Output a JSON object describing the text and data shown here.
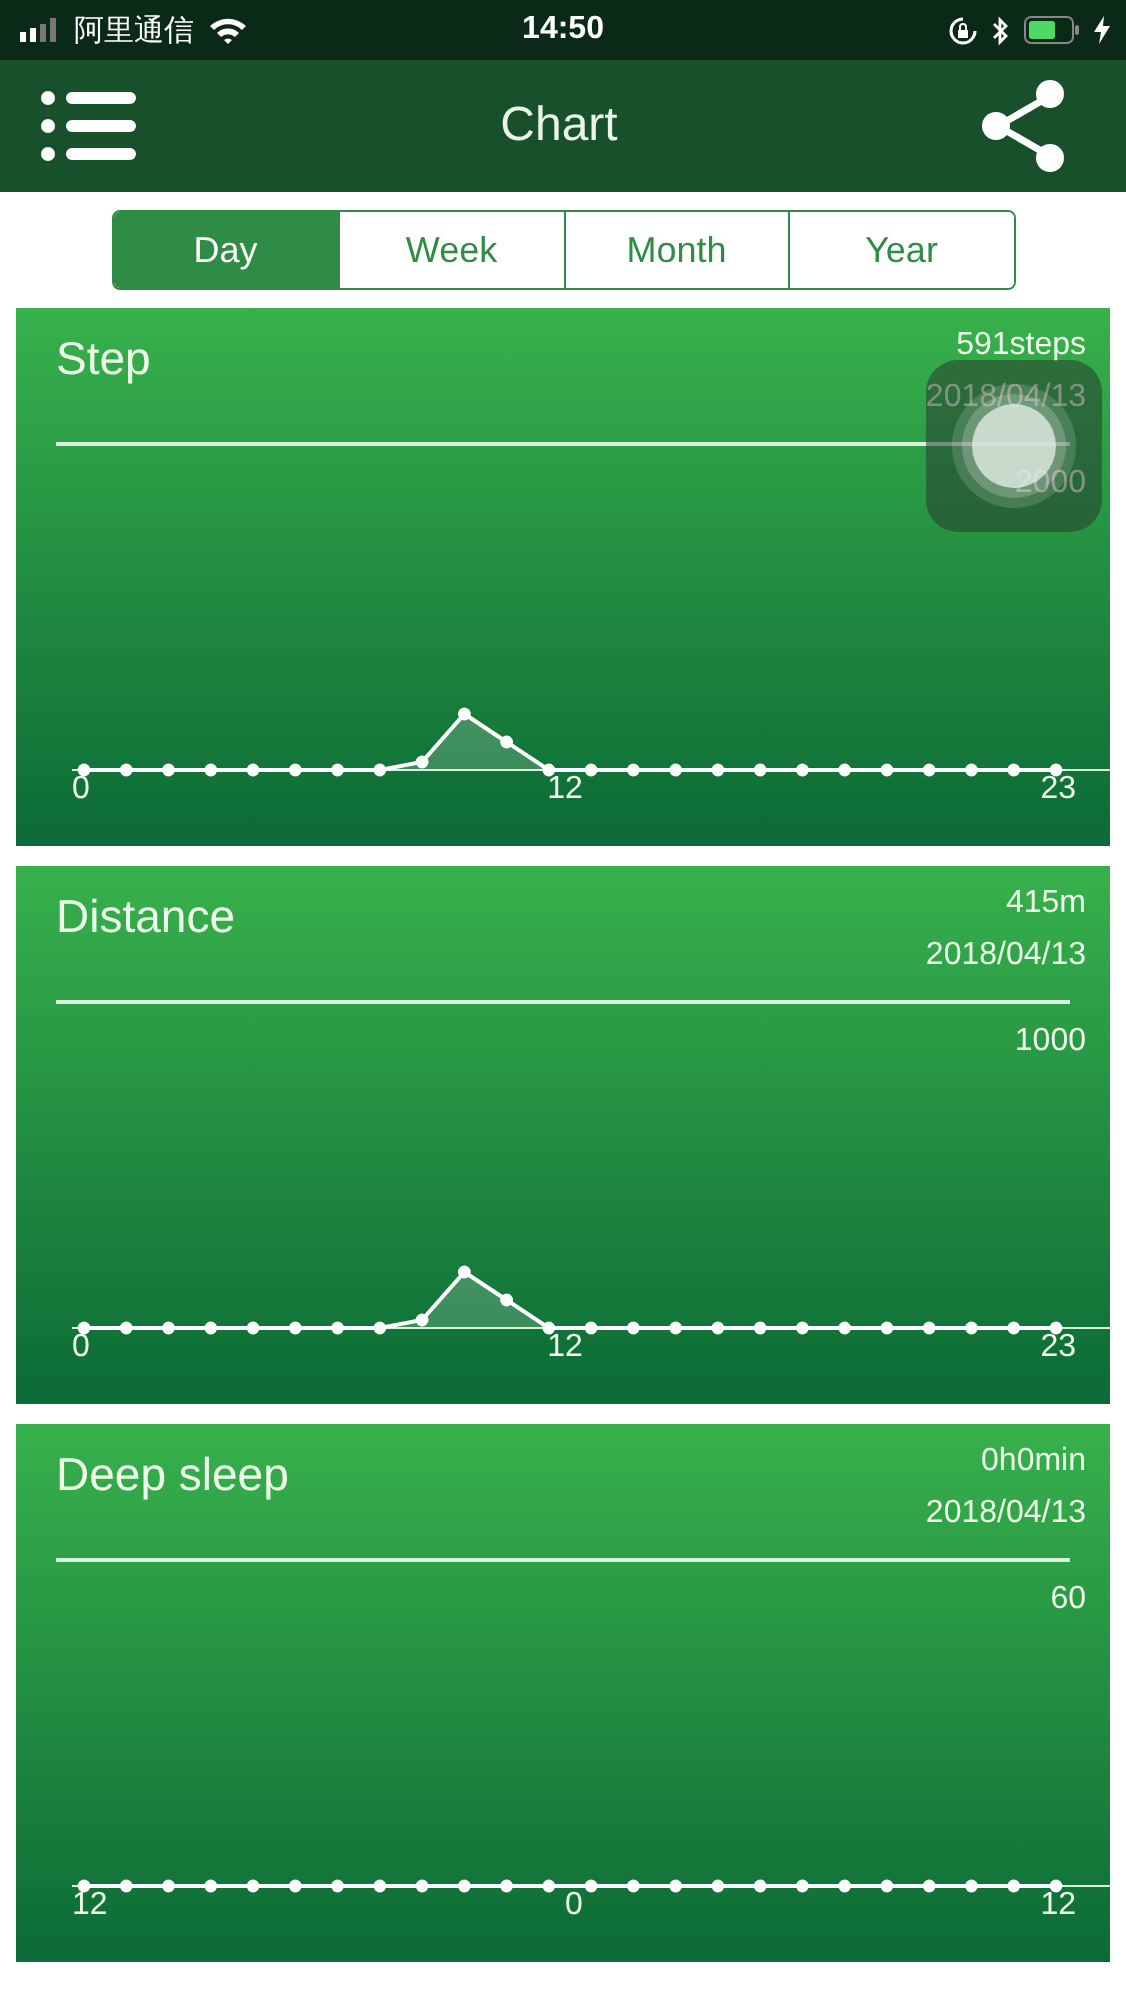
{
  "status_bar": {
    "carrier": "阿里通信",
    "time": "14:50"
  },
  "nav": {
    "title": "Chart"
  },
  "tabs": [
    {
      "label": "Day",
      "selected": true
    },
    {
      "label": "Week",
      "selected": false
    },
    {
      "label": "Month",
      "selected": false
    },
    {
      "label": "Year",
      "selected": false
    }
  ],
  "charts": [
    {
      "title": "Step",
      "value": "591steps",
      "date": "2018/04/13",
      "max_label": "2000",
      "x_labels": [
        "0",
        "12",
        "23"
      ],
      "kind": "peak"
    },
    {
      "title": "Distance",
      "value": "415m",
      "date": "2018/04/13",
      "max_label": "1000",
      "x_labels": [
        "0",
        "12",
        "23"
      ],
      "kind": "peak"
    },
    {
      "title": "Deep sleep",
      "value": "0h0min",
      "date": "2018/04/13",
      "max_label": "60",
      "x_labels": [
        "12",
        "0",
        "12"
      ],
      "kind": "flat"
    }
  ]
}
